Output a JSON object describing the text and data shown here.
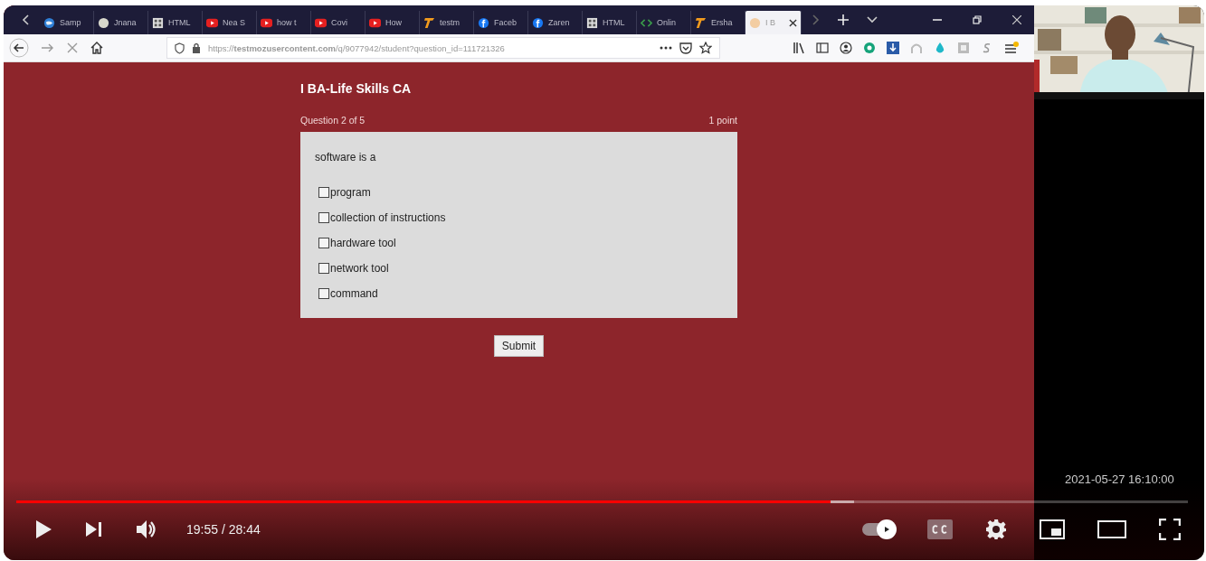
{
  "video": {
    "browser": {
      "tabs": [
        {
          "label": "Samp",
          "kind": "globe",
          "selected": false
        },
        {
          "label": "Jnana",
          "kind": "circle",
          "selected": false
        },
        {
          "label": "HTML",
          "kind": "grid",
          "selected": false
        },
        {
          "label": "Nea S",
          "kind": "video",
          "selected": false
        },
        {
          "label": "how t",
          "kind": "video",
          "selected": false
        },
        {
          "label": "Covi",
          "kind": "video",
          "selected": false
        },
        {
          "label": "How",
          "kind": "video",
          "selected": false
        },
        {
          "label": "testm",
          "kind": "flag",
          "selected": false
        },
        {
          "label": "Faceb",
          "kind": "social",
          "selected": false
        },
        {
          "label": "Zaren",
          "kind": "social",
          "selected": false
        },
        {
          "label": "HTML",
          "kind": "grid",
          "selected": false
        },
        {
          "label": "Onlin",
          "kind": "code",
          "selected": false
        },
        {
          "label": "Ersha",
          "kind": "flag",
          "selected": false
        },
        {
          "label": "I B",
          "kind": "blank",
          "selected": true
        }
      ],
      "address_bar": {
        "url": "https://**testmozusercontent.com**/q/9077942/student?question_id=111721326"
      }
    },
    "page": {
      "title": "I BA-Life Skills CA",
      "question_counter": "Question 2 of 5",
      "points": "1 point",
      "prompt": "software is a",
      "options": [
        {
          "label": "program",
          "checked": false
        },
        {
          "label": "collection of instructions",
          "checked": false
        },
        {
          "label": "hardware tool",
          "checked": false
        },
        {
          "label": "network tool",
          "checked": false
        },
        {
          "label": "command",
          "checked": false
        }
      ],
      "submit": "Submit"
    },
    "timestamp": "2021-05-27 16:10:00",
    "player": {
      "progress": {
        "level": 0.695
      },
      "time": "19:55 / 28:44",
      "autoplay": {
        "on": true
      }
    }
  }
}
